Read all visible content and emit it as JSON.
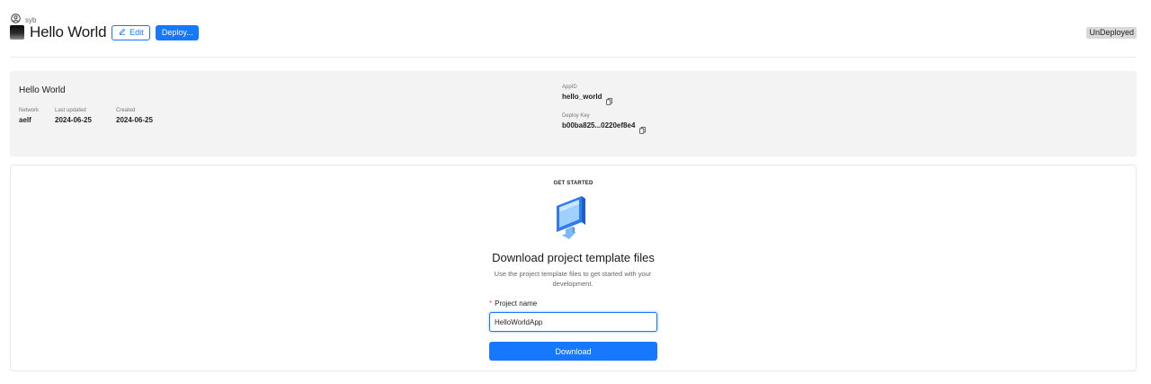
{
  "user": {
    "name": "syb",
    "icon": "user-circle-icon"
  },
  "header": {
    "title": "Hello World",
    "edit_label": "Edit",
    "deploy_label": "Deploy...",
    "status": "UnDeployed"
  },
  "info": {
    "title": "Hello World",
    "network": {
      "label": "Network",
      "value": "aelf"
    },
    "last_updated": {
      "label": "Last updated",
      "value": "2024-06-25"
    },
    "created": {
      "label": "Created",
      "value": "2024-06-25"
    },
    "app_id": {
      "label": "AppID",
      "value": "hello_world"
    },
    "deploy_key": {
      "label": "Deploy Key",
      "value": "b00ba825...0220ef8e4"
    }
  },
  "get_started": {
    "heading": "GET STARTED",
    "title": "Download project template files",
    "description": "Use the project template files to get started with your development.",
    "project_name_label": "Project name",
    "project_name_required": "*",
    "project_name_value": "HelloWorldApp",
    "download_label": "Download"
  },
  "colors": {
    "primary": "#1677ff",
    "panel_bg": "#f3f3f3",
    "badge_bg": "#d9d9d9"
  }
}
